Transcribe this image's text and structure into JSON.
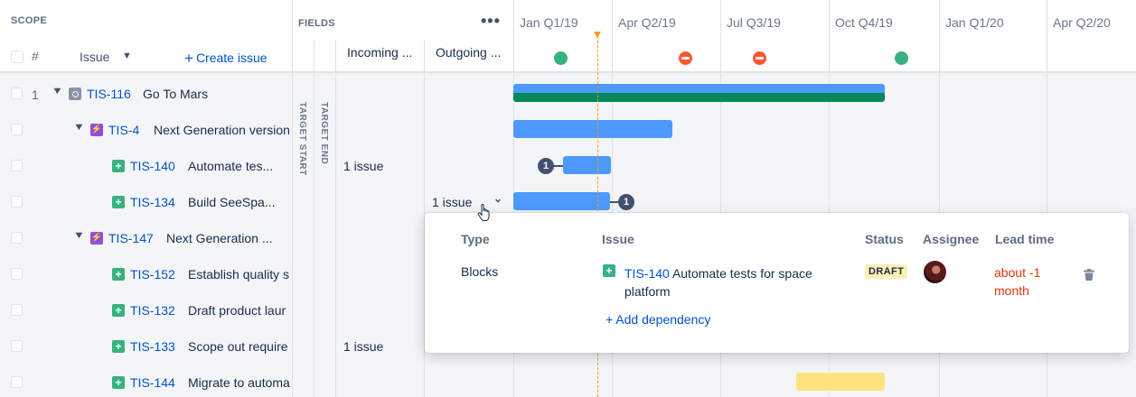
{
  "scope": {
    "label": "SCOPE",
    "hash_label": "#",
    "issue_col_label": "Issue",
    "create_issue_label": "Create issue"
  },
  "fields": {
    "label": "FIELDS",
    "more_icon": "more-horizontal-icon",
    "columns": [
      "Incoming ...",
      "Outgoing ..."
    ],
    "target_start_label": "TARGET START",
    "target_end_label": "TARGET END"
  },
  "timeline": {
    "periods": [
      "Jan Q1/19",
      "Apr Q2/19",
      "Jul Q3/19",
      "Oct Q4/19",
      "Jan Q1/20",
      "Apr Q2/20"
    ],
    "today_color": "#ff991f",
    "milestones": [
      {
        "status": "done",
        "color": "#36b37e"
      },
      {
        "status": "blocked",
        "color": "#ff5630"
      },
      {
        "status": "blocked",
        "color": "#ff5630"
      },
      {
        "status": "done",
        "color": "#36b37e"
      }
    ]
  },
  "rows": [
    {
      "num": "1",
      "key": "TIS-116",
      "summary": "Go To Mars",
      "type": "epic",
      "incoming": "",
      "outgoing": ""
    },
    {
      "num": "",
      "key": "TIS-4",
      "summary": "Next Generation version",
      "type": "initiative",
      "incoming": "",
      "outgoing": ""
    },
    {
      "num": "",
      "key": "TIS-140",
      "summary": "Automate tes...",
      "type": "story",
      "incoming": "1 issue",
      "outgoing": "",
      "badge": "1"
    },
    {
      "num": "",
      "key": "TIS-134",
      "summary": "Build SeeSpa...",
      "type": "story",
      "incoming": "",
      "outgoing": "1 issue",
      "badge": "1"
    },
    {
      "num": "",
      "key": "TIS-147",
      "summary": "Next Generation ...",
      "type": "initiative",
      "incoming": "",
      "outgoing": ""
    },
    {
      "num": "",
      "key": "TIS-152",
      "summary": "Establish quality s",
      "type": "story",
      "incoming": "",
      "outgoing": ""
    },
    {
      "num": "",
      "key": "TIS-132",
      "summary": "Draft product laur",
      "type": "story",
      "incoming": "",
      "outgoing": ""
    },
    {
      "num": "",
      "key": "TIS-133",
      "summary": "Scope out require",
      "type": "story",
      "incoming": "1 issue",
      "outgoing": ""
    },
    {
      "num": "",
      "key": "TIS-144",
      "summary": "Migrate to automa",
      "type": "story",
      "incoming": "",
      "outgoing": ""
    }
  ],
  "popup": {
    "headers": {
      "type": "Type",
      "issue": "Issue",
      "status": "Status",
      "assignee": "Assignee",
      "lead_time": "Lead time"
    },
    "dependency": {
      "type": "Blocks",
      "key": "TIS-140",
      "summary": "Automate tests for space platform",
      "status": "DRAFT",
      "lead_time": "about -1 month"
    },
    "add_dependency_label": "+ Add dependency"
  }
}
